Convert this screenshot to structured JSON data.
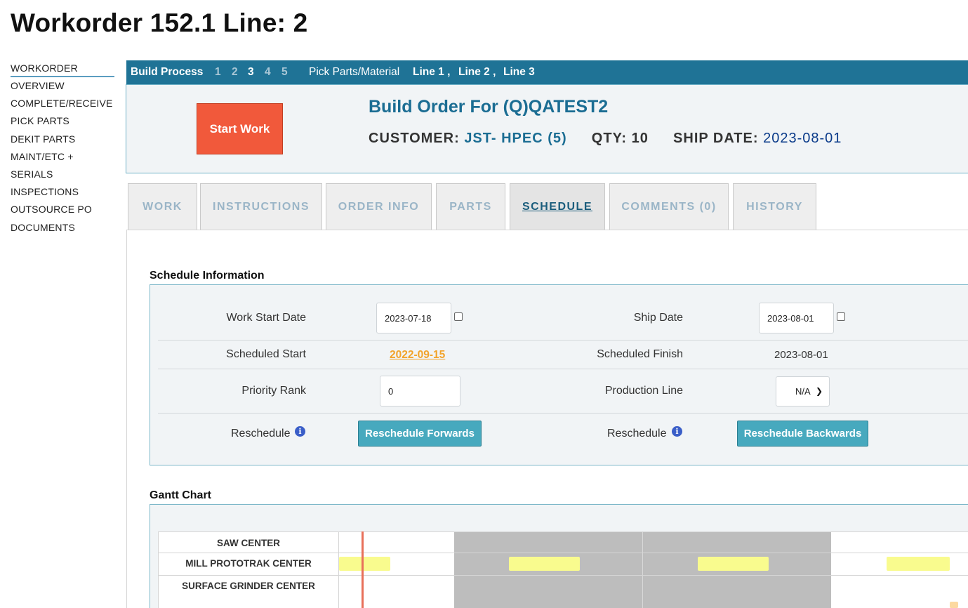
{
  "page": {
    "title": "Workorder 152.1 Line: 2"
  },
  "sidebar": {
    "items": [
      {
        "label": "WORKORDER",
        "active": true
      },
      {
        "label": "OVERVIEW"
      },
      {
        "label": "COMPLETE/RECEIVE"
      },
      {
        "label": "PICK PARTS"
      },
      {
        "label": "DEKIT PARTS"
      },
      {
        "label": "MAINT/ETC +"
      },
      {
        "label": "SERIALS"
      },
      {
        "label": "INSPECTIONS"
      },
      {
        "label": "OUTSOURCE PO"
      },
      {
        "label": "DOCUMENTS"
      }
    ]
  },
  "build_bar": {
    "label": "Build Process",
    "steps": [
      "1",
      "2",
      "3",
      "4",
      "5"
    ],
    "current_step": "3",
    "pick_label": "Pick Parts/Material",
    "lines": [
      "Line 1 ,",
      "Line 2 ,",
      "Line 3"
    ]
  },
  "order": {
    "start_button": "Start Work",
    "title": "Build Order For (Q)QATEST2",
    "customer_label": "CUSTOMER:",
    "customer_value": "JST- HPEC (5)",
    "qty_label": "QTY:",
    "qty_value": "10",
    "ship_label": "SHIP DATE:",
    "ship_value": "2023-08-01"
  },
  "tabs": [
    {
      "label": "WORK"
    },
    {
      "label": "INSTRUCTIONS"
    },
    {
      "label": "ORDER INFO"
    },
    {
      "label": "PARTS"
    },
    {
      "label": "SCHEDULE",
      "active": true
    },
    {
      "label": "COMMENTS (0)"
    },
    {
      "label": "HISTORY"
    }
  ],
  "schedule": {
    "section_title": "Schedule Information",
    "work_start_label": "Work Start Date",
    "work_start_value": "2023-07-18",
    "ship_date_label": "Ship Date",
    "ship_date_value": "2023-08-01",
    "scheduled_start_label": "Scheduled Start",
    "scheduled_start_value": "2022-09-15",
    "scheduled_finish_label": "Scheduled Finish",
    "scheduled_finish_value": "2023-08-01",
    "priority_label": "Priority Rank",
    "priority_value": "0",
    "production_line_label": "Production Line",
    "production_line_value": "N/A",
    "reschedule_label": "Reschedule",
    "reschedule_forwards": "Reschedule Forwards",
    "reschedule_backwards": "Reschedule Backwards"
  },
  "gantt": {
    "section_title": "Gantt Chart",
    "rows": [
      "SAW CENTER",
      "MILL PROTOTRAK CENTER",
      "SURFACE GRINDER CENTER"
    ],
    "colors": {
      "bar": "#f9fb8e",
      "shade": "#bdbdbd",
      "today": "#e8705a"
    }
  },
  "colors": {
    "header_bar": "#1f7396",
    "accent": "#1b6d93",
    "start_button": "#f1593b",
    "teal_button": "#47a9be",
    "link_orange": "#f2a32a"
  }
}
